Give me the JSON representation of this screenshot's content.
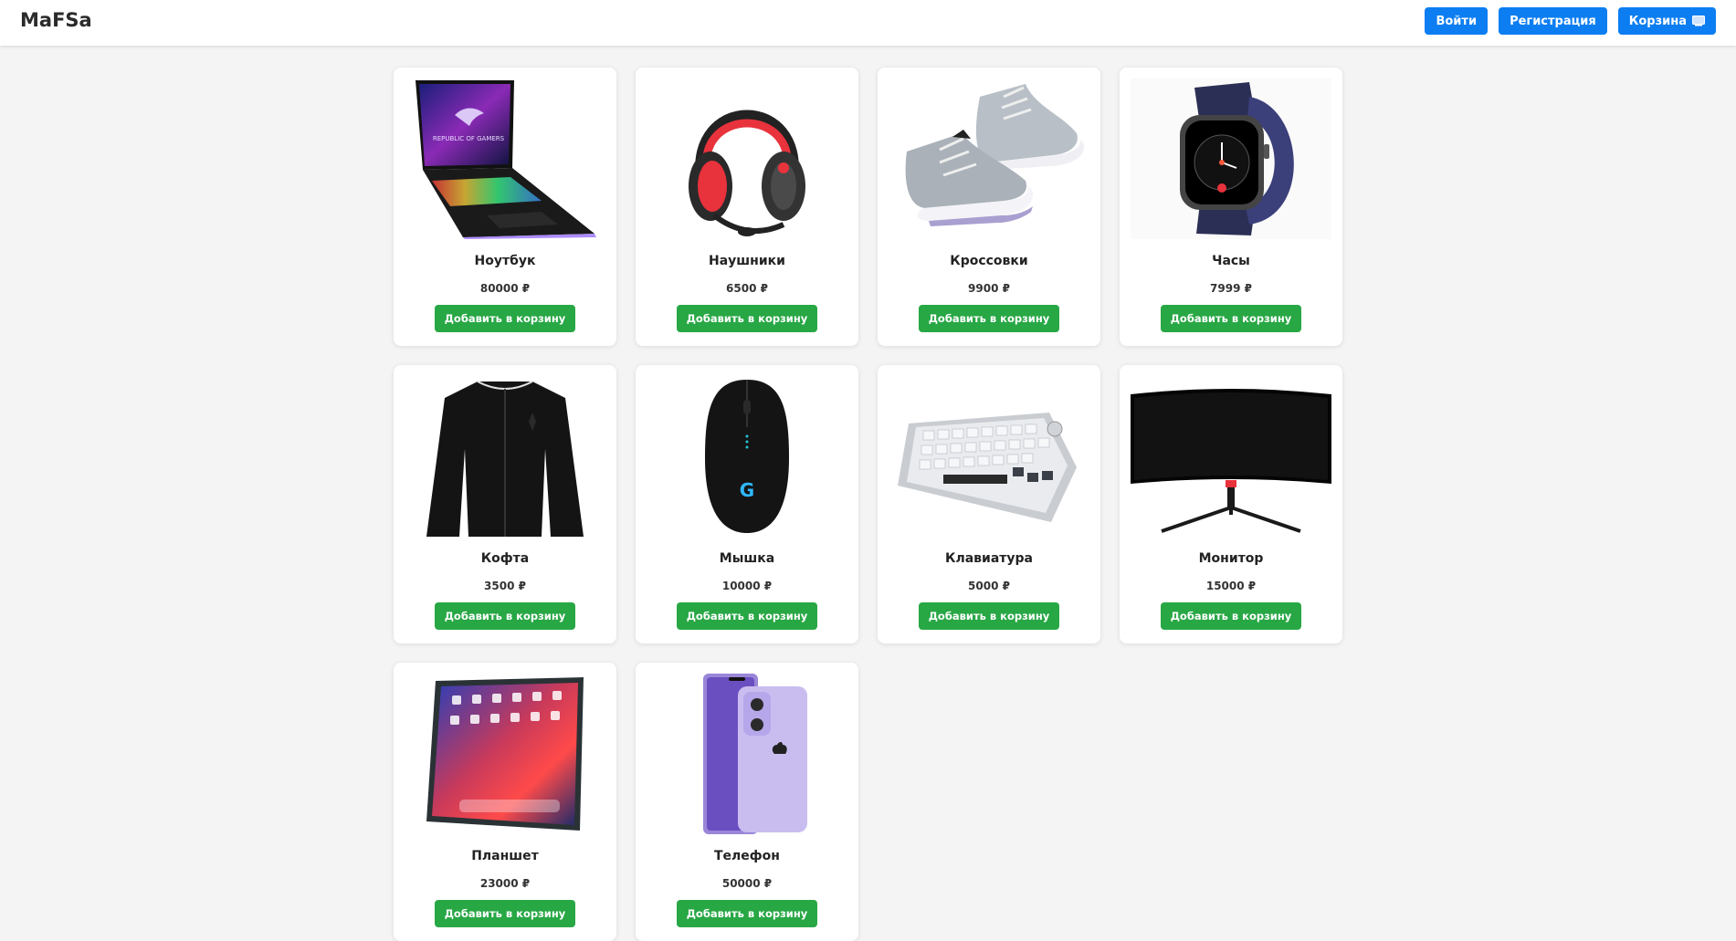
{
  "header": {
    "logo": "MaFSa",
    "login_label": "Войти",
    "register_label": "Регистрация",
    "cart_label": "Корзина",
    "cart_icon": "cart-icon"
  },
  "colors": {
    "primary_button": "#0d7ef2",
    "add_button": "#28a745",
    "background": "#f4f4f4"
  },
  "products": [
    {
      "name": "Ноутбук",
      "price": "80000 ₽",
      "button": "Добавить в корзину",
      "image": "laptop-image"
    },
    {
      "name": "Наушники",
      "price": "6500 ₽",
      "button": "Добавить в корзину",
      "image": "headphones-image"
    },
    {
      "name": "Кроссовки",
      "price": "9900 ₽",
      "button": "Добавить в корзину",
      "image": "sneakers-image"
    },
    {
      "name": "Часы",
      "price": "7999 ₽",
      "button": "Добавить в корзину",
      "image": "watch-image"
    },
    {
      "name": "Кофта",
      "price": "3500 ₽",
      "button": "Добавить в корзину",
      "image": "jacket-image"
    },
    {
      "name": "Мышка",
      "price": "10000 ₽",
      "button": "Добавить в корзину",
      "image": "mouse-image"
    },
    {
      "name": "Клавиатура",
      "price": "5000 ₽",
      "button": "Добавить в корзину",
      "image": "keyboard-image"
    },
    {
      "name": "Монитор",
      "price": "15000 ₽",
      "button": "Добавить в корзину",
      "image": "monitor-image"
    },
    {
      "name": "Планшет",
      "price": "23000 ₽",
      "button": "Добавить в корзину",
      "image": "tablet-image"
    },
    {
      "name": "Телефон",
      "price": "50000 ₽",
      "button": "Добавить в корзину",
      "image": "phone-image"
    }
  ]
}
